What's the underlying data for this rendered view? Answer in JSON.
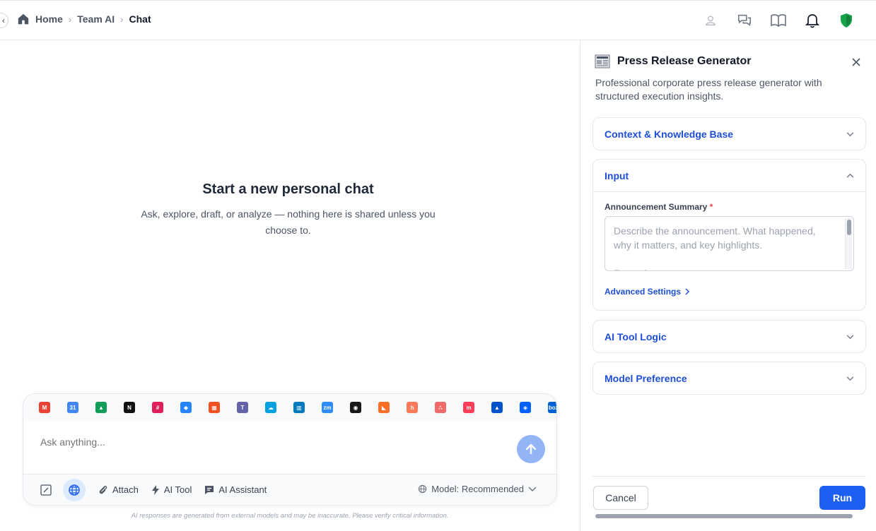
{
  "breadcrumb": {
    "home": "Home",
    "team": "Team AI",
    "current": "Chat"
  },
  "topbar_icons": [
    "user-icon",
    "chat-bubbles-icon",
    "book-icon",
    "bell-icon",
    "shield-icon"
  ],
  "main": {
    "title": "Start a new personal chat",
    "subtitle": "Ask, explore, draft, or analyze — nothing here is shared unless you choose to."
  },
  "composer": {
    "apps": [
      {
        "name": "gmail-icon",
        "color": "#ea4335",
        "glyph": "M"
      },
      {
        "name": "google-calendar-icon",
        "color": "#4285f4",
        "glyph": "31"
      },
      {
        "name": "google-drive-icon",
        "color": "#0f9d58",
        "glyph": "▲"
      },
      {
        "name": "notion-icon",
        "color": "#111111",
        "glyph": "N"
      },
      {
        "name": "slack-icon",
        "color": "#e01e5a",
        "glyph": "#"
      },
      {
        "name": "jira-icon",
        "color": "#2684ff",
        "glyph": "◆"
      },
      {
        "name": "microsoft-icon",
        "color": "#f25022",
        "glyph": "▦"
      },
      {
        "name": "teams-icon",
        "color": "#6264a7",
        "glyph": "T"
      },
      {
        "name": "salesforce-icon",
        "color": "#00a1e0",
        "glyph": "☁"
      },
      {
        "name": "trello-icon",
        "color": "#0079bf",
        "glyph": "▥"
      },
      {
        "name": "zoom-icon",
        "color": "#2d8cff",
        "glyph": "zm"
      },
      {
        "name": "github-icon",
        "color": "#181717",
        "glyph": "◉"
      },
      {
        "name": "gitlab-icon",
        "color": "#fc6d26",
        "glyph": "◣"
      },
      {
        "name": "hubspot-icon",
        "color": "#ff7a59",
        "glyph": "h"
      },
      {
        "name": "asana-icon",
        "color": "#f06a6a",
        "glyph": "∴"
      },
      {
        "name": "monday-icon",
        "color": "#ff3d57",
        "glyph": "m"
      },
      {
        "name": "atlassian-icon",
        "color": "#0052cc",
        "glyph": "▲"
      },
      {
        "name": "dropbox-icon",
        "color": "#0061ff",
        "glyph": "◈"
      },
      {
        "name": "box-icon",
        "color": "#0061d5",
        "glyph": "box"
      }
    ],
    "placeholder": "Ask anything...",
    "attach_label": "Attach",
    "ai_tool_label": "AI Tool",
    "ai_assistant_label": "AI Assistant",
    "model_label": "Model: Recommended"
  },
  "disclaimer": "AI responses are generated from external models and may be inaccurate. Please verify critical information.",
  "panel": {
    "title": "Press Release Generator",
    "description": "Professional corporate press release generator with structured execution insights.",
    "sections": {
      "context": "Context & Knowledge Base",
      "input": "Input",
      "logic": "AI Tool Logic",
      "model": "Model Preference"
    },
    "field_label": "Announcement Summary",
    "field_required": "*",
    "field_placeholder": "Describe the announcement. What happened, why it matters, and key highlights.\n\nExamples:",
    "advanced_label": "Advanced Settings",
    "cancel_label": "Cancel",
    "run_label": "Run"
  },
  "colors": {
    "accent": "#1d5ff0",
    "link": "#1d4ed8",
    "shield": "#16a34a"
  }
}
